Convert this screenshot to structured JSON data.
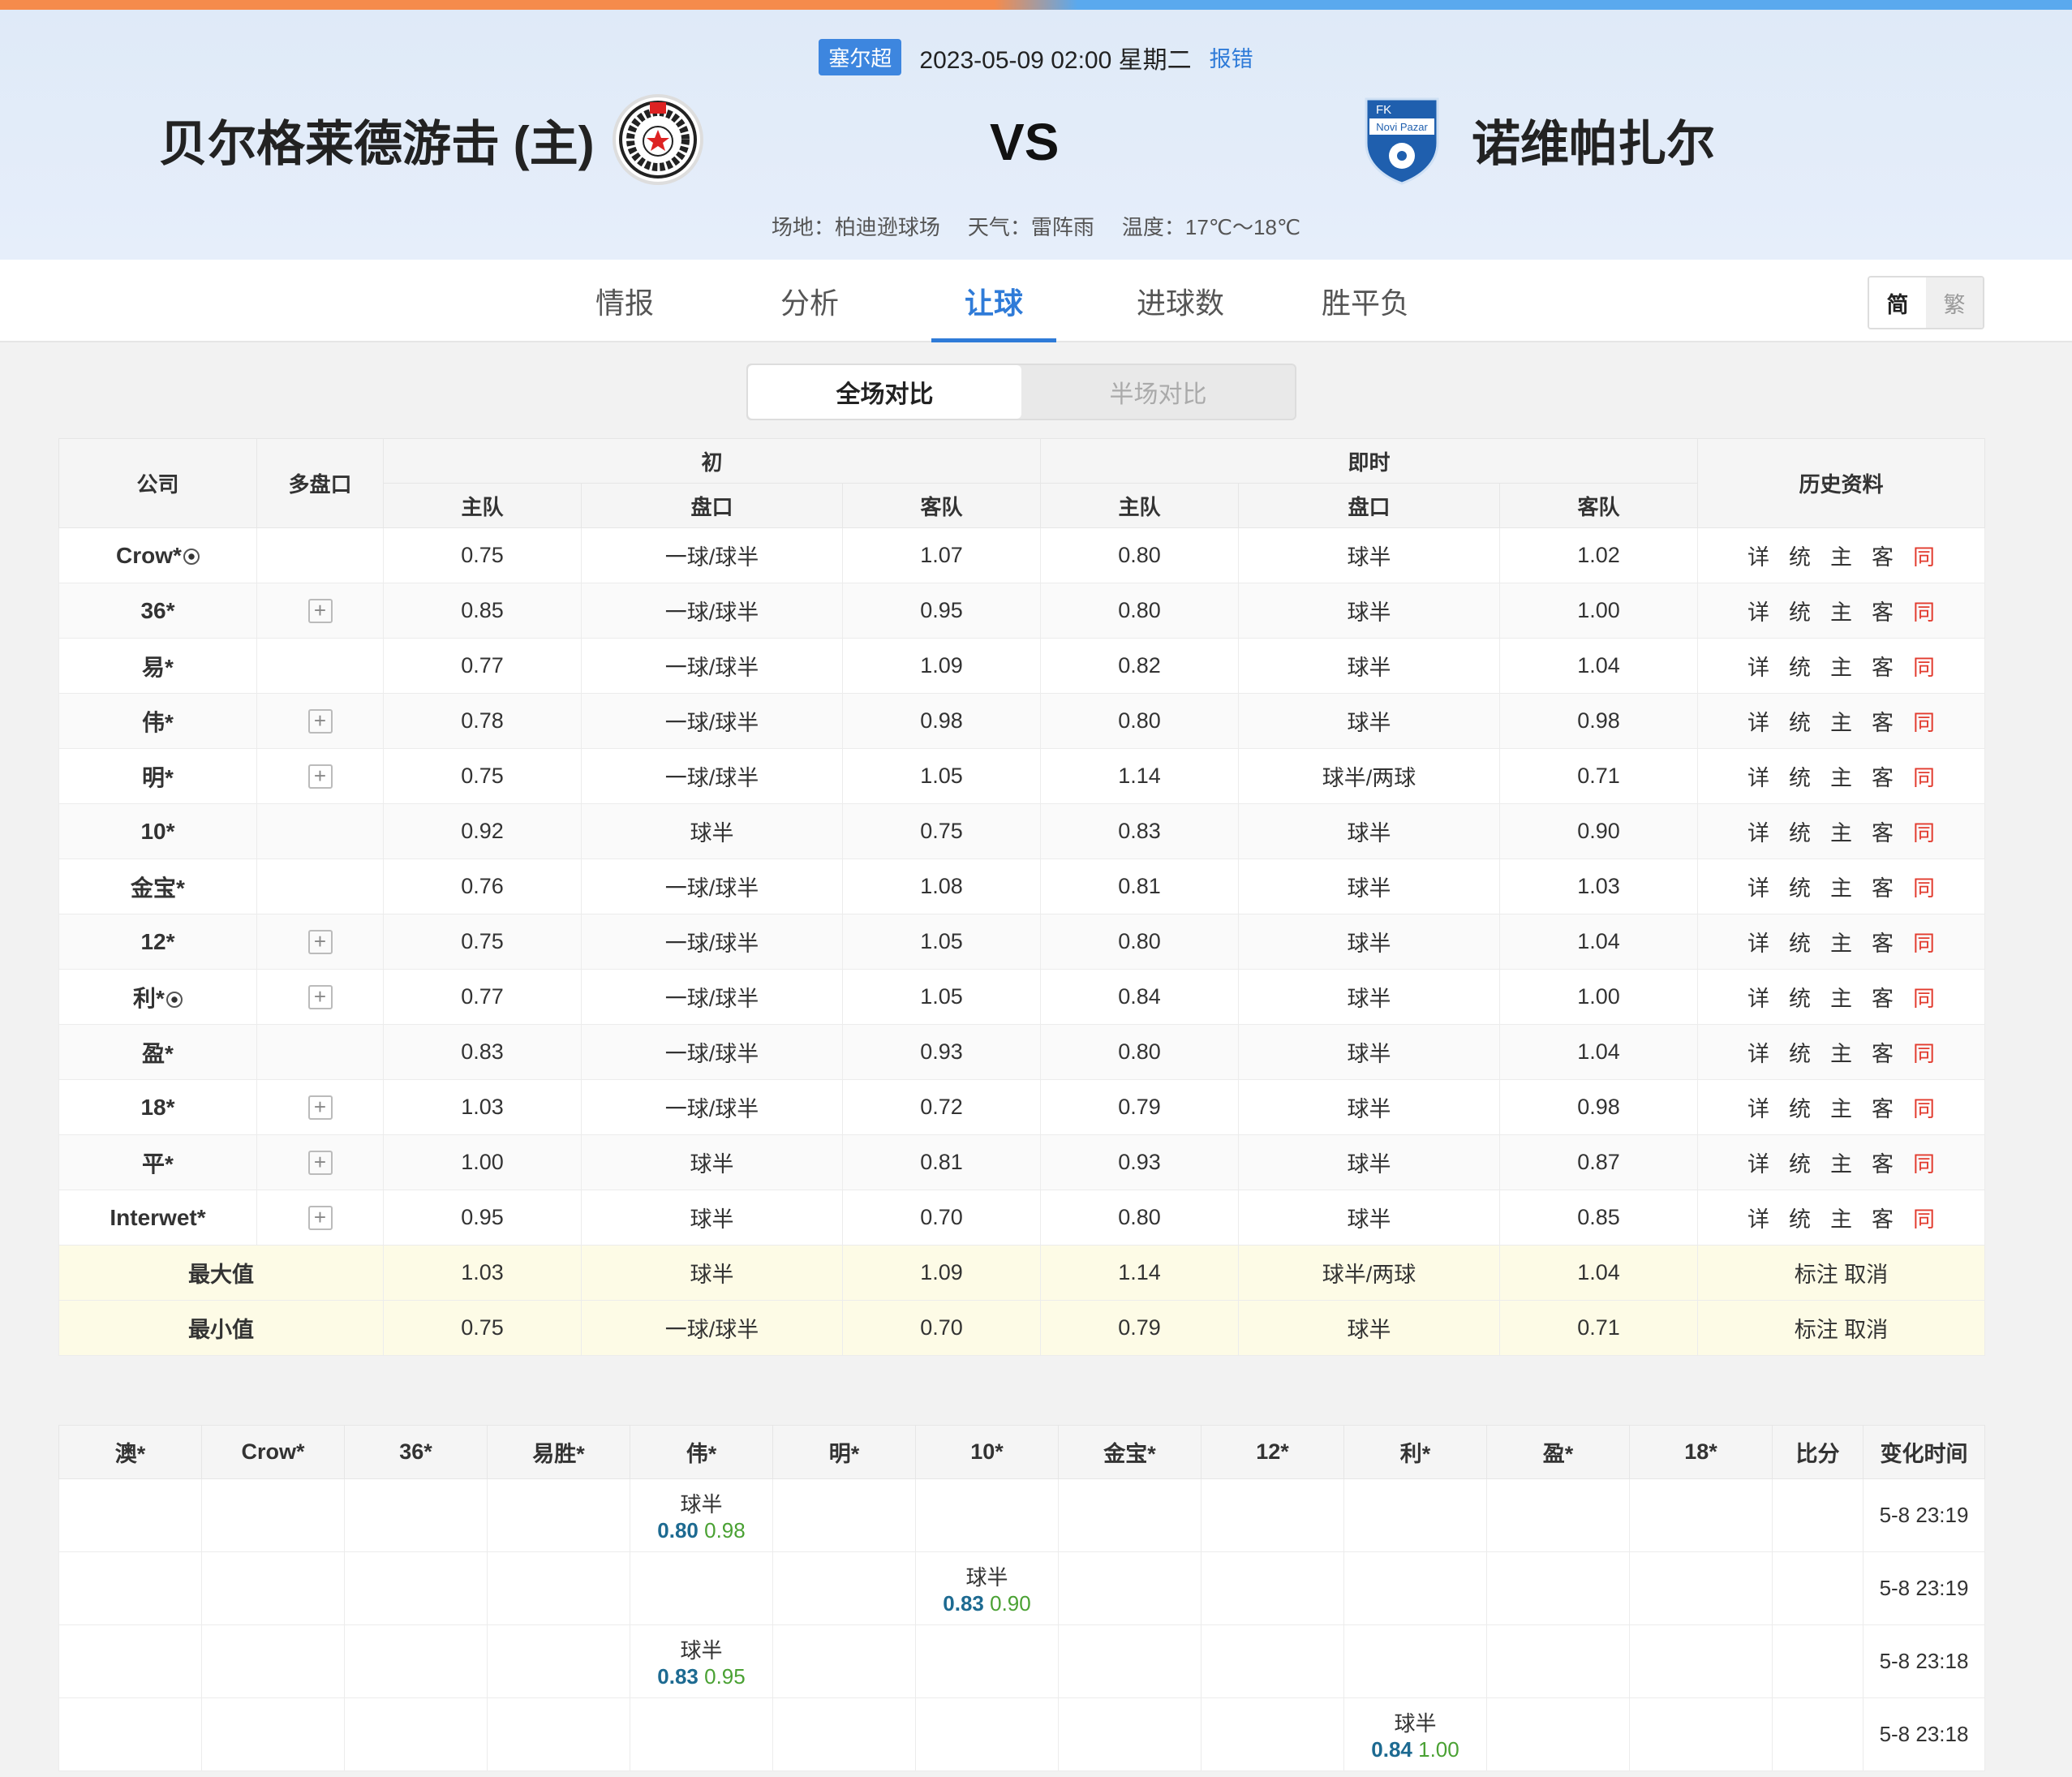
{
  "header": {
    "league": "塞尔超",
    "datetime": "2023-05-09 02:00 星期二",
    "report": "报错",
    "home_team": "贝尔格莱德游击 (主)",
    "away_team": "诺维帕扎尔",
    "vs": "VS",
    "venue": "场地：柏迪逊球场",
    "weather": "天气：雷阵雨",
    "temperature": "温度：17℃～18℃",
    "away_logo_text": "FK",
    "away_logo_text2": "Novi Pazar"
  },
  "tabs": [
    "情报",
    "分析",
    "让球",
    "进球数",
    "胜平负"
  ],
  "active_tab": "让球",
  "lang": {
    "simplified": "简",
    "traditional": "繁"
  },
  "segment": {
    "full": "全场对比",
    "half": "半场对比"
  },
  "odds_table": {
    "headers": {
      "company": "公司",
      "multi": "多盘口",
      "initial": "初",
      "live": "即时",
      "history": "历史资料",
      "home": "主队",
      "line": "盘口",
      "away": "客队"
    },
    "history_links": [
      "详",
      "统",
      "主",
      "客",
      "同"
    ],
    "rows": [
      {
        "company": "Crow*",
        "ball": true,
        "multi": false,
        "i_home": "0.75",
        "i_line": "一球/球半",
        "i_away": "1.07",
        "l_home": "0.80",
        "l_line": "球半",
        "l_away": "1.02"
      },
      {
        "company": "36*",
        "ball": false,
        "multi": true,
        "i_home": "0.85",
        "i_line": "一球/球半",
        "i_away": "0.95",
        "l_home": "0.80",
        "l_line": "球半",
        "l_away": "1.00"
      },
      {
        "company": "易*",
        "ball": false,
        "multi": false,
        "i_home": "0.77",
        "i_line": "一球/球半",
        "i_away": "1.09",
        "l_home": "0.82",
        "l_line": "球半",
        "l_away": "1.04"
      },
      {
        "company": "伟*",
        "ball": false,
        "multi": true,
        "i_home": "0.78",
        "i_line": "一球/球半",
        "i_away": "0.98",
        "l_home": "0.80",
        "l_line": "球半",
        "l_away": "0.98"
      },
      {
        "company": "明*",
        "ball": false,
        "multi": true,
        "i_home": "0.75",
        "i_line": "一球/球半",
        "i_away": "1.05",
        "l_home": "1.14",
        "l_line": "球半/两球",
        "l_away": "0.71"
      },
      {
        "company": "10*",
        "ball": false,
        "multi": false,
        "i_home": "0.92",
        "i_line": "球半",
        "i_away": "0.75",
        "l_home": "0.83",
        "l_line": "球半",
        "l_away": "0.90"
      },
      {
        "company": "金宝*",
        "ball": false,
        "multi": false,
        "i_home": "0.76",
        "i_line": "一球/球半",
        "i_away": "1.08",
        "l_home": "0.81",
        "l_line": "球半",
        "l_away": "1.03"
      },
      {
        "company": "12*",
        "ball": false,
        "multi": true,
        "i_home": "0.75",
        "i_line": "一球/球半",
        "i_away": "1.05",
        "l_home": "0.80",
        "l_line": "球半",
        "l_away": "1.04"
      },
      {
        "company": "利*",
        "ball": true,
        "multi": true,
        "i_home": "0.77",
        "i_line": "一球/球半",
        "i_away": "1.05",
        "l_home": "0.84",
        "l_line": "球半",
        "l_away": "1.00"
      },
      {
        "company": "盈*",
        "ball": false,
        "multi": false,
        "i_home": "0.83",
        "i_line": "一球/球半",
        "i_away": "0.93",
        "l_home": "0.80",
        "l_line": "球半",
        "l_away": "1.04"
      },
      {
        "company": "18*",
        "ball": false,
        "multi": true,
        "i_home": "1.03",
        "i_line": "一球/球半",
        "i_away": "0.72",
        "l_home": "0.79",
        "l_line": "球半",
        "l_away": "0.98"
      },
      {
        "company": "平*",
        "ball": false,
        "multi": true,
        "i_home": "1.00",
        "i_line": "球半",
        "i_away": "0.81",
        "l_home": "0.93",
        "l_line": "球半",
        "l_away": "0.87"
      },
      {
        "company": "Interwet*",
        "ball": false,
        "multi": true,
        "i_home": "0.95",
        "i_line": "球半",
        "i_away": "0.70",
        "l_home": "0.80",
        "l_line": "球半",
        "l_away": "0.85"
      }
    ],
    "summary": [
      {
        "label": "最大值",
        "i_home": "1.03",
        "i_line": "球半",
        "i_away": "1.09",
        "l_home": "1.14",
        "l_line": "球半/两球",
        "l_away": "1.04",
        "mark": "标注",
        "cancel": "取消"
      },
      {
        "label": "最小值",
        "i_home": "0.75",
        "i_line": "一球/球半",
        "i_away": "0.70",
        "l_home": "0.79",
        "l_line": "球半",
        "l_away": "0.71",
        "mark": "标注",
        "cancel": "取消"
      }
    ]
  },
  "changes_table": {
    "headers": [
      "澳*",
      "Crow*",
      "36*",
      "易胜*",
      "伟*",
      "明*",
      "10*",
      "金宝*",
      "12*",
      "利*",
      "盈*",
      "18*",
      "比分",
      "变化时间"
    ],
    "rows": [
      {
        "col": 4,
        "line": "球半",
        "home": "0.80",
        "away": "0.98",
        "time": "5-8 23:19"
      },
      {
        "col": 6,
        "line": "球半",
        "home": "0.83",
        "away": "0.90",
        "time": "5-8 23:19"
      },
      {
        "col": 4,
        "line": "球半",
        "home": "0.83",
        "away": "0.95",
        "time": "5-8 23:18"
      },
      {
        "col": 9,
        "line": "球半",
        "home": "0.84",
        "away": "1.00",
        "time": "5-8 23:18"
      }
    ]
  },
  "colors": {
    "accent": "#2f7bd8",
    "league_badge": "#3d86df",
    "history_red": "#e23b2e",
    "odds_home": "#1d6a91",
    "odds_away": "#4aa133",
    "summary_bg": "#fdfbe6"
  }
}
